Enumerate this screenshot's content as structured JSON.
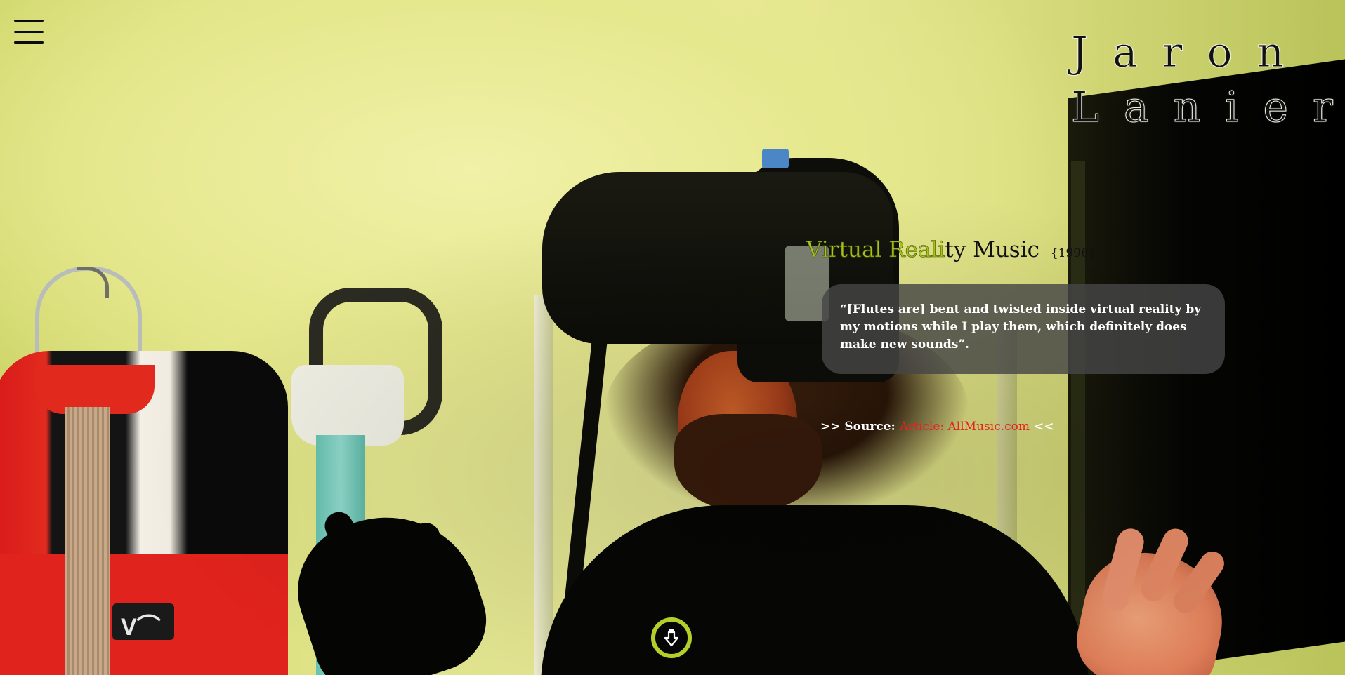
{
  "header": {
    "menu_icon": "hamburger-menu-icon",
    "title_line1": "Jaron",
    "title_line2": "Lanier"
  },
  "project": {
    "title_highlight": "Virtual Reali",
    "title_rest": "ty Music",
    "year": "{1996}"
  },
  "quote": {
    "text": "“[Flutes are] bent and twisted inside virtual reality by my motions while I play them, which definitely does make new sounds”."
  },
  "source": {
    "prefix": ">> Source: ",
    "link_text": "Article: AllMusic.com",
    "suffix": " <<"
  },
  "scroll_button": {
    "icon": "download-arrow-icon"
  },
  "colors": {
    "accent_green": "#b4cf2a",
    "link_red": "#e5231f",
    "quote_box": "#464646"
  }
}
